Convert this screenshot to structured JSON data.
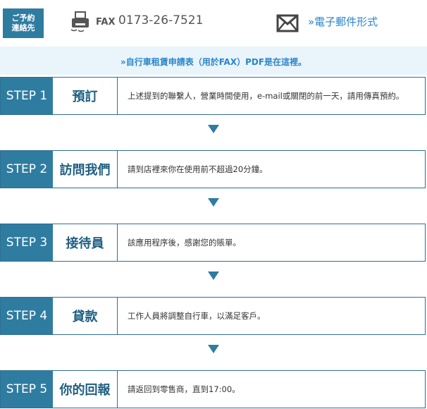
{
  "header": {
    "contact_badge": "ご予約\n連絡先",
    "fax_label": "FAX",
    "fax_number": "0173-26-7521",
    "email_link": "»電子郵件形式"
  },
  "banner": {
    "link_text": "»自行車租賃申請表（用於FAX）PDF是在這裡。"
  },
  "steps": [
    {
      "number": "STEP 1",
      "title": "預訂",
      "description": "上述提到的聯繫人，營業時間使用，e-mail或關閉的前一天，請用傳真預約。"
    },
    {
      "number": "STEP 2",
      "title": "訪問我們",
      "description": "請到店裡來你在使用前不超過20分鐘。"
    },
    {
      "number": "STEP 3",
      "title": "接待員",
      "description": "該應用程序後，感謝您的賬單。"
    },
    {
      "number": "STEP 4",
      "title": "貸款",
      "description": "工作人員將調整自行車，以滿足客戶。"
    },
    {
      "number": "STEP 5",
      "title": "你的回報",
      "description": "請返回到零售商，直到17:00。"
    }
  ],
  "colors": {
    "primary": "#2f7ca1",
    "link": "#2a86c9",
    "banner_bg": "#e9f4fb"
  }
}
